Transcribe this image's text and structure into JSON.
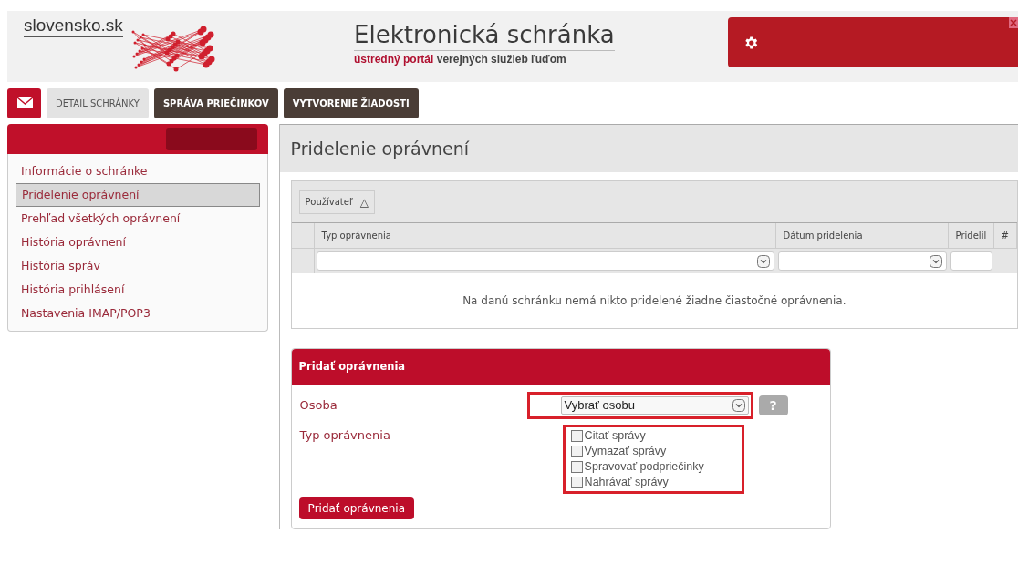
{
  "header": {
    "logo_text": "slovensko.sk",
    "title": "Elektronická schránka",
    "subtitle_highlight": "ústredný portál",
    "subtitle_rest": "verejných služieb ľuďom"
  },
  "nav_tabs": [
    {
      "label": "DETAIL SCHRÁNKY",
      "selected": true
    },
    {
      "label": "SPRÁVA PRIEČINKOV",
      "selected": false
    },
    {
      "label": "VYTVORENIE ŽIADOSTI",
      "selected": false
    }
  ],
  "sidebar": {
    "items": [
      {
        "label": "Informácie o schránke",
        "selected": false
      },
      {
        "label": "Pridelenie oprávnení",
        "selected": true
      },
      {
        "label": "Prehľad všetkých oprávnení",
        "selected": false
      },
      {
        "label": "História oprávnení",
        "selected": false
      },
      {
        "label": "História správ",
        "selected": false
      },
      {
        "label": "História prihlásení",
        "selected": false
      },
      {
        "label": "Nastavenia IMAP/POP3",
        "selected": false
      }
    ]
  },
  "page_title": "Pridelenie oprávnení",
  "table": {
    "group_by": "Používateľ",
    "group_icon": "△",
    "columns": [
      "Typ oprávnenia",
      "Dátum pridelenia",
      "Pridelil",
      "#"
    ],
    "empty_message": "Na danú schránku nemá nikto pridelené žiadne čiastočné oprávnenia."
  },
  "add_form": {
    "title": "Pridať oprávnenia",
    "person_label": "Osoba",
    "person_value": "Vybrať osobu",
    "help": "?",
    "type_label": "Typ oprávnenia",
    "options": [
      {
        "label": "Citať správy",
        "checked": false
      },
      {
        "label": "Vymazať správy",
        "checked": false
      },
      {
        "label": "Spravovať podpriečinky",
        "checked": false
      },
      {
        "label": "Nahrávať správy",
        "checked": false
      }
    ],
    "submit": "Pridať oprávnenia"
  }
}
